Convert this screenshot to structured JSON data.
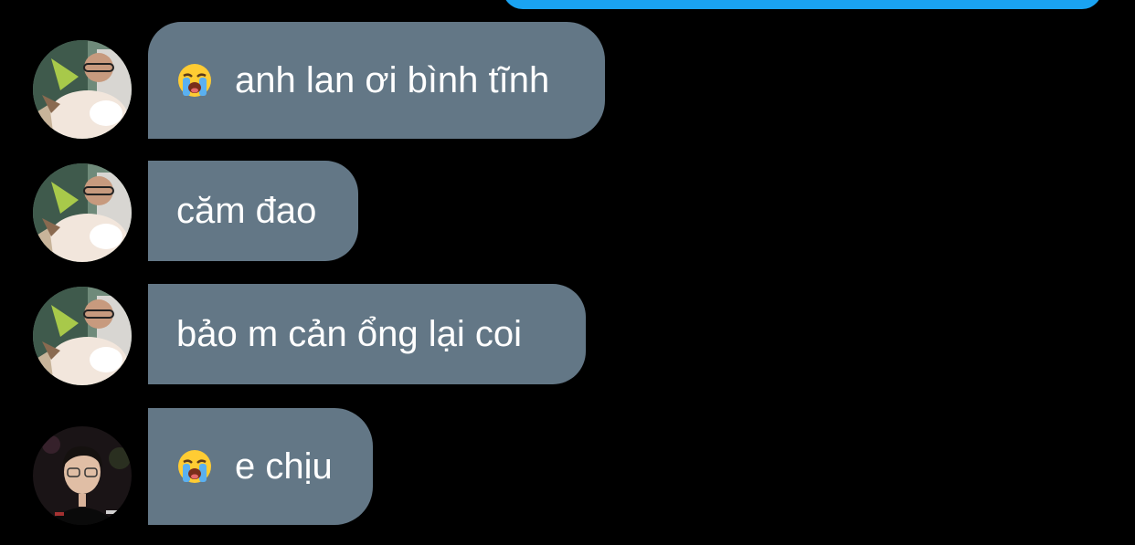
{
  "thread": {
    "outgoing_color": "#1aa3f2",
    "incoming_color": "#637786",
    "background": "#000000",
    "messages": [
      {
        "sender": "contact-cat",
        "emoji": "loudly-crying-face-icon",
        "text": "anh lan ơi bình tĩnh"
      },
      {
        "sender": "contact-cat",
        "emoji": "",
        "text": "căm đao"
      },
      {
        "sender": "contact-cat",
        "emoji": "",
        "text": "bảo m cản ổng lại coi"
      },
      {
        "sender": "contact-person",
        "emoji": "loudly-crying-face-icon",
        "text": "e chịu"
      }
    ]
  }
}
